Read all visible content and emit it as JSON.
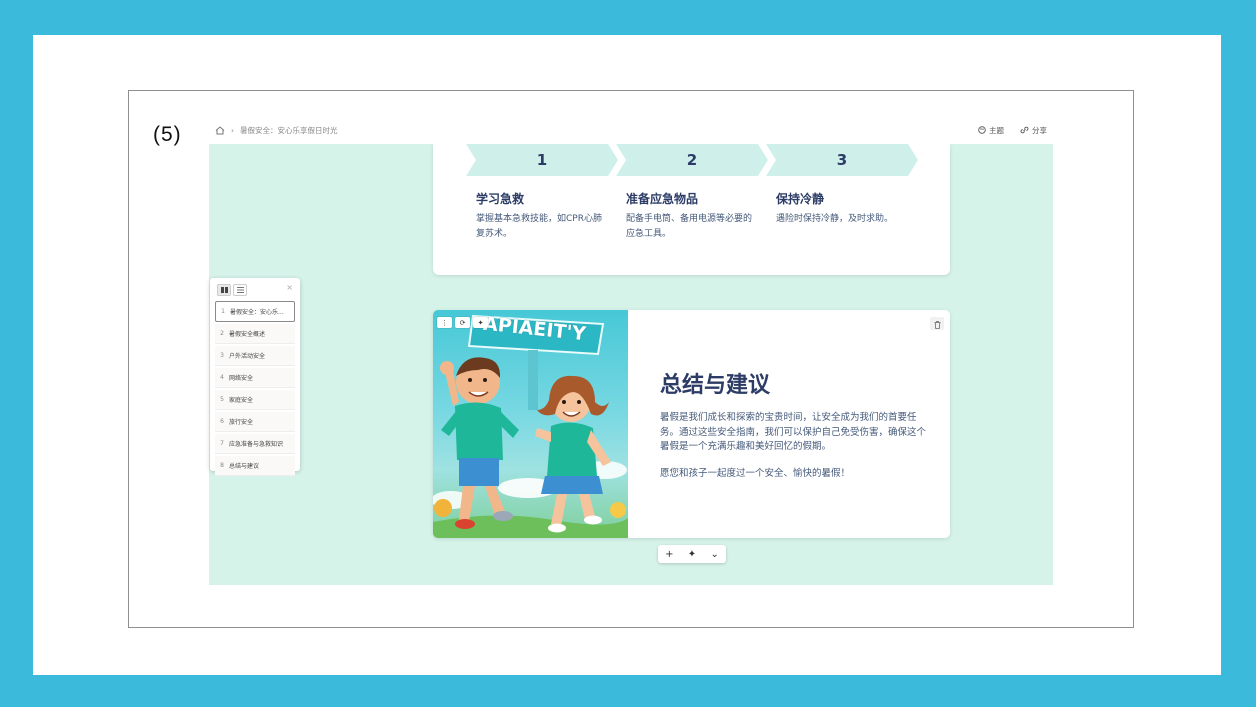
{
  "step_label": "(5)",
  "header": {
    "breadcrumb_title": "暑假安全：安心乐享假日时光",
    "theme_label": "主题",
    "share_label": "分享"
  },
  "steps": [
    {
      "number": "1",
      "title": "学习急救",
      "desc": "掌握基本急救技能，如CPR心肺复苏术。"
    },
    {
      "number": "2",
      "title": "准备应急物品",
      "desc": "配备手电筒、备用电源等必要的应急工具。"
    },
    {
      "number": "3",
      "title": "保持冷静",
      "desc": "遇险时保持冷静，及时求助。"
    }
  ],
  "summary_card": {
    "image_sign_text": "APIAEIT'Y",
    "title": "总结与建议",
    "paragraph1": "暑假是我们成长和探索的宝贵时间，让安全成为我们的首要任务。通过这些安全指南，我们可以保护自己免受伤害，确保这个暑假是一个充满乐趣和美好回忆的假期。",
    "paragraph2": "愿您和孩子一起度过一个安全、愉快的暑假！"
  },
  "bottom_toolbar": {
    "add": "+",
    "ai": "✦",
    "more": "⌄"
  },
  "outline": {
    "close": "×",
    "items": [
      {
        "num": "1",
        "label": "暑假安全：安心乐..."
      },
      {
        "num": "2",
        "label": "暑假安全概述"
      },
      {
        "num": "3",
        "label": "户外活动安全"
      },
      {
        "num": "4",
        "label": "网络安全"
      },
      {
        "num": "5",
        "label": "家庭安全"
      },
      {
        "num": "6",
        "label": "旅行安全"
      },
      {
        "num": "7",
        "label": "应急准备与急救知识"
      },
      {
        "num": "8",
        "label": "总结与建议"
      }
    ]
  },
  "colors": {
    "accent": "#2d3c66",
    "canvas": "#d6f3ea",
    "border_blue": "#3bbadc"
  }
}
